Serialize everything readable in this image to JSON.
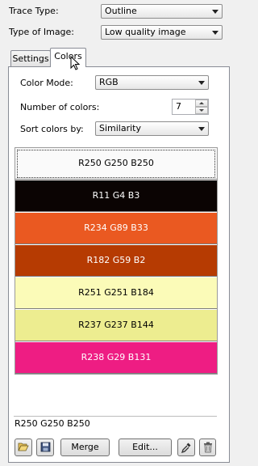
{
  "settings": {
    "trace_type_label": "Trace Type:",
    "trace_type_value": "Outline",
    "image_type_label": "Type of Image:",
    "image_type_value": "Low quality image"
  },
  "tabs": [
    {
      "label": "Settings",
      "active": false
    },
    {
      "label": "Colors",
      "active": true
    }
  ],
  "colors_panel": {
    "color_mode_label": "Color Mode:",
    "color_mode_value": "RGB",
    "num_colors_label": "Number of colors:",
    "num_colors_value": "7",
    "sort_label": "Sort colors by:",
    "sort_value": "Similarity",
    "swatches": [
      {
        "label": "R250 G250 B250",
        "bg": "#fafafa",
        "fg": "#000000"
      },
      {
        "label": "R11 G4 B3",
        "bg": "#0b0403",
        "fg": "#ffffff"
      },
      {
        "label": "R234 G89 B33",
        "bg": "#ea5921",
        "fg": "#ffffff"
      },
      {
        "label": "R182 G59 B2",
        "bg": "#b63b02",
        "fg": "#ffffff"
      },
      {
        "label": "R251 G251 B184",
        "bg": "#fbfbb8",
        "fg": "#000000"
      },
      {
        "label": "R237 G237 B144",
        "bg": "#eded90",
        "fg": "#000000"
      },
      {
        "label": "R238 G29 B131",
        "bg": "#ee1d83",
        "fg": "#ffffff"
      }
    ],
    "selected_color_text": "R250 G250 B250"
  },
  "toolbar": {
    "open_icon": "folder-open-icon",
    "save_icon": "floppy-disk-icon",
    "merge_label": "Merge",
    "edit_label": "Edit...",
    "eyedropper_icon": "eyedropper-icon",
    "delete_icon": "trash-icon"
  }
}
